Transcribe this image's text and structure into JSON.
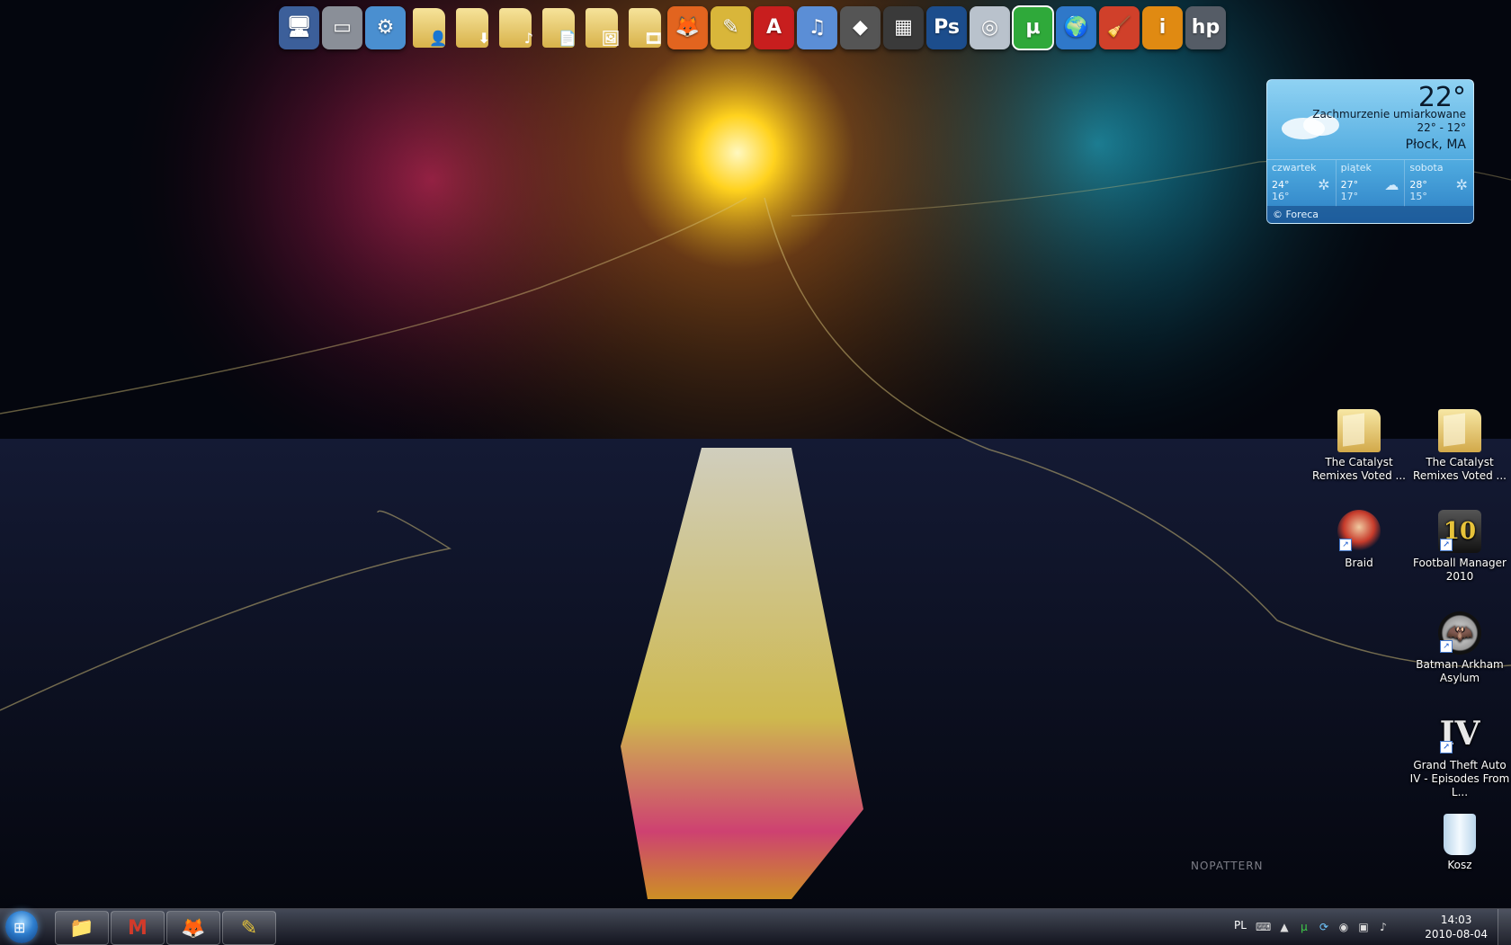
{
  "dock": {
    "items": [
      {
        "name": "computer-icon",
        "glyph": "🖥",
        "bg": "#3c5f9a"
      },
      {
        "name": "drive-icon",
        "glyph": "▭",
        "bg": "#8a8f98"
      },
      {
        "name": "control-panel-icon",
        "glyph": "⚙",
        "bg": "#4a8fd0"
      },
      {
        "name": "user-folder-icon",
        "glyph": "👤",
        "bg": "folder"
      },
      {
        "name": "downloads-folder-icon",
        "glyph": "⬇",
        "bg": "folder"
      },
      {
        "name": "music-folder-icon",
        "glyph": "♪",
        "bg": "folder"
      },
      {
        "name": "documents-folder-icon",
        "glyph": "📄",
        "bg": "folder"
      },
      {
        "name": "pictures-folder-icon",
        "glyph": "🖼",
        "bg": "folder"
      },
      {
        "name": "videos-folder-icon",
        "glyph": "🎞",
        "bg": "folder"
      },
      {
        "name": "firefox-icon",
        "glyph": "🦊",
        "bg": "#e2641f"
      },
      {
        "name": "wizard-icon",
        "glyph": "✎",
        "bg": "#d9b63a"
      },
      {
        "name": "alcohol-icon",
        "glyph": "A",
        "bg": "#c81e1e"
      },
      {
        "name": "itunes-icon",
        "glyph": "♫",
        "bg": "#5b8ed6"
      },
      {
        "name": "foobar-icon",
        "glyph": "◆",
        "bg": "#555"
      },
      {
        "name": "media-icon",
        "glyph": "▦",
        "bg": "#3a3a3a"
      },
      {
        "name": "photoshop-icon",
        "glyph": "Ps",
        "bg": "#1c4d8c"
      },
      {
        "name": "disc-icon",
        "glyph": "◎",
        "bg": "#b9c2cc"
      },
      {
        "name": "utorrent-icon",
        "glyph": "μ",
        "bg": "#2fa93a",
        "selected": true
      },
      {
        "name": "globe-icon",
        "glyph": "🌍",
        "bg": "#2f78c9"
      },
      {
        "name": "cleaner-icon",
        "glyph": "🧹",
        "bg": "#d0402a"
      },
      {
        "name": "info-icon",
        "glyph": "i",
        "bg": "#e08a12"
      },
      {
        "name": "hp-icon",
        "glyph": "hp",
        "bg": "#555c66"
      }
    ]
  },
  "weather": {
    "temp": "22°",
    "condition": "Zachmurzenie umiarkowane",
    "range": "22°  - 12°",
    "city": "Płock, MA",
    "forecast": [
      {
        "day": "czwartek",
        "hi": "24°",
        "lo": "16°",
        "icon": "✲"
      },
      {
        "day": "piątek",
        "hi": "27°",
        "lo": "17°",
        "icon": "☁"
      },
      {
        "day": "sobota",
        "hi": "28°",
        "lo": "15°",
        "icon": "✲"
      }
    ],
    "credit": "© Foreca"
  },
  "desktop": {
    "icons": [
      {
        "label": "The Catalyst Remixes Voted ...",
        "type": "folder"
      },
      {
        "label": "The Catalyst Remixes Voted ...",
        "type": "folder"
      },
      {
        "label": "Braid",
        "type": "braid"
      },
      {
        "label": "Football Manager 2010",
        "type": "fm",
        "art": "10"
      },
      {
        "label": "Batman Arkham Asylum",
        "type": "batman",
        "art": "🦇"
      },
      {
        "label": "Grand Theft Auto IV - Episodes From L...",
        "type": "gta",
        "art": "IV"
      },
      {
        "label": "Kosz",
        "type": "bin"
      }
    ]
  },
  "wallpaper_logo": "NOPATTERN",
  "taskbar": {
    "start_glyph": "⊞",
    "buttons": [
      {
        "name": "explorer-icon",
        "glyph": "📁"
      },
      {
        "name": "gmail-icon",
        "glyph": "M"
      },
      {
        "name": "firefox-icon",
        "glyph": "🦊"
      },
      {
        "name": "wizard-icon",
        "glyph": "✎"
      }
    ],
    "tray": {
      "lang": "PL",
      "time": "14:03",
      "date": "2010-08-04"
    }
  }
}
